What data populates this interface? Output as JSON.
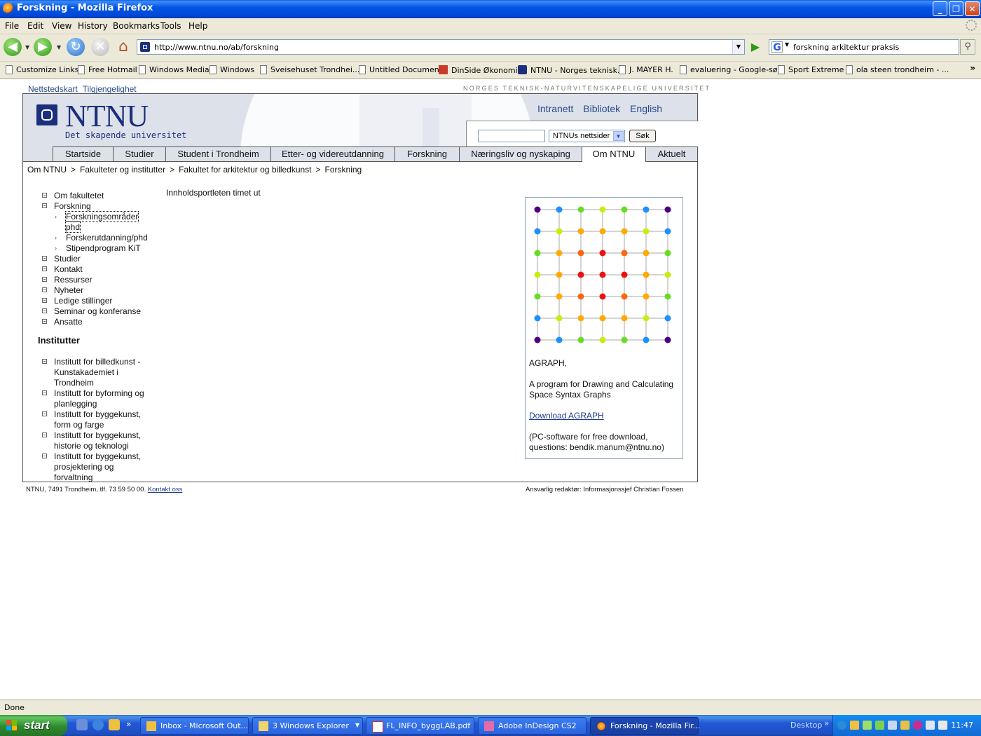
{
  "window": {
    "title": "Forskning - Mozilla Firefox",
    "controls": {
      "minimize": "_",
      "maximize": "❐",
      "close": "✕"
    }
  },
  "menu": [
    "File",
    "Edit",
    "View",
    "History",
    "Bookmarks",
    "Tools",
    "Help"
  ],
  "toolbar": {
    "url": "http://www.ntnu.no/ab/forskning",
    "search_query": "forskning arkitektur praksis",
    "search_engine_icon": "G"
  },
  "bookmarks": [
    "Customize Links",
    "Free Hotmail",
    "Windows Media",
    "Windows",
    "Sveisehuset Trondhei...",
    "Untitled Document",
    "DinSide Økonomi -",
    "NTNU - Norges teknisk...",
    "J. MAYER H.",
    "evaluering - Google-søk",
    "Sport Extreme",
    "ola steen trondheim - ..."
  ],
  "page": {
    "top_links": [
      "Nettstedskart",
      "Tilgjengelighet"
    ],
    "university_name": "NORGES TEKNISK-NATURVITENSKAPELIGE UNIVERSITET",
    "logo_text": "NTNU",
    "logo_sub": "Det skapende universitet",
    "header_links": [
      "Intranett",
      "Bibliotek",
      "English"
    ],
    "search": {
      "select_value": "NTNUs nettsider",
      "button": "Søk"
    },
    "tabs": [
      "Startside",
      "Studier",
      "Student i Trondheim",
      "Etter- og videreutdanning",
      "Forskning",
      "Næringsliv og nyskaping",
      "Om NTNU",
      "Aktuelt"
    ],
    "active_tab": "Om NTNU",
    "breadcrumb": [
      "Om NTNU",
      "Fakulteter og institutter",
      "Fakultet for arkitektur og billedkunst",
      "Forskning"
    ],
    "breadcrumb_sep": ">",
    "left_nav": {
      "items": [
        "Om fakultetet",
        "Forskning"
      ],
      "sub_items": [
        "Forskningsområder",
        "phd",
        "Forskerutdanning/phd",
        "Stipendprogram KiT"
      ],
      "items2": [
        "Studier",
        "Kontakt",
        "Ressurser",
        "Nyheter",
        "Ledige stillinger",
        "Seminar og konferanse",
        "Ansatte"
      ]
    },
    "institutes_heading": "Institutter",
    "institutes": [
      [
        "Institutt for billedkunst -",
        "Kunstakademiet i",
        "Trondheim"
      ],
      [
        "Institutt for byforming og",
        "planlegging"
      ],
      [
        "Institutt for byggekunst,",
        "form og farge"
      ],
      [
        "Institutt for byggekunst,",
        "historie og teknologi"
      ],
      [
        "Institutt for byggekunst,",
        "prosjektering og",
        "forvaltning"
      ]
    ],
    "main_message": "Innholdsportleten timet ut",
    "agraph": {
      "title": "AGRAPH,",
      "desc1": "A program for Drawing and Calculating",
      "desc2": "Space Syntax Graphs",
      "link": "Download AGRAPH",
      "note1": "(PC-software for free download,",
      "note2": "questions: bendik.manum@ntnu.no)",
      "grid_colors": [
        [
          "#4b0082",
          "#1e90ff",
          "#66dd22",
          "#c8ee11",
          "#66dd22",
          "#1e90ff",
          "#4b0082"
        ],
        [
          "#1e90ff",
          "#c8ee11",
          "#ffaa00",
          "#ffaa00",
          "#ffaa00",
          "#c8ee11",
          "#1e90ff"
        ],
        [
          "#66dd22",
          "#ffaa00",
          "#ff6611",
          "#ee1111",
          "#ff6611",
          "#ffaa00",
          "#66dd22"
        ],
        [
          "#c8ee11",
          "#ffaa00",
          "#ee1111",
          "#ee1111",
          "#ee1111",
          "#ffaa00",
          "#c8ee11"
        ],
        [
          "#66dd22",
          "#ffaa00",
          "#ff6611",
          "#ee1111",
          "#ff6611",
          "#ffaa00",
          "#66dd22"
        ],
        [
          "#1e90ff",
          "#c8ee11",
          "#ffaa00",
          "#ffaa00",
          "#ffaa00",
          "#c8ee11",
          "#1e90ff"
        ],
        [
          "#4b0082",
          "#1e90ff",
          "#66dd22",
          "#c8ee11",
          "#66dd22",
          "#1e90ff",
          "#4b0082"
        ]
      ]
    },
    "footer_left": "NTNU, 7491 Trondheim, tlf. 73 59 50 00.",
    "footer_left_link": "Kontakt oss",
    "footer_right": "Ansvarlig redaktør: Informasjonssjef Christian Fossen"
  },
  "status": "Done",
  "taskbar": {
    "start": "start",
    "tasks": [
      "Inbox - Microsoft Out...",
      "3 Windows Explorer",
      "FL_INFO_byggLAB.pdf",
      "Adobe InDesign CS2",
      "Forskning - Mozilla Fir..."
    ],
    "desktop": "Desktop",
    "clock": "11:47"
  }
}
